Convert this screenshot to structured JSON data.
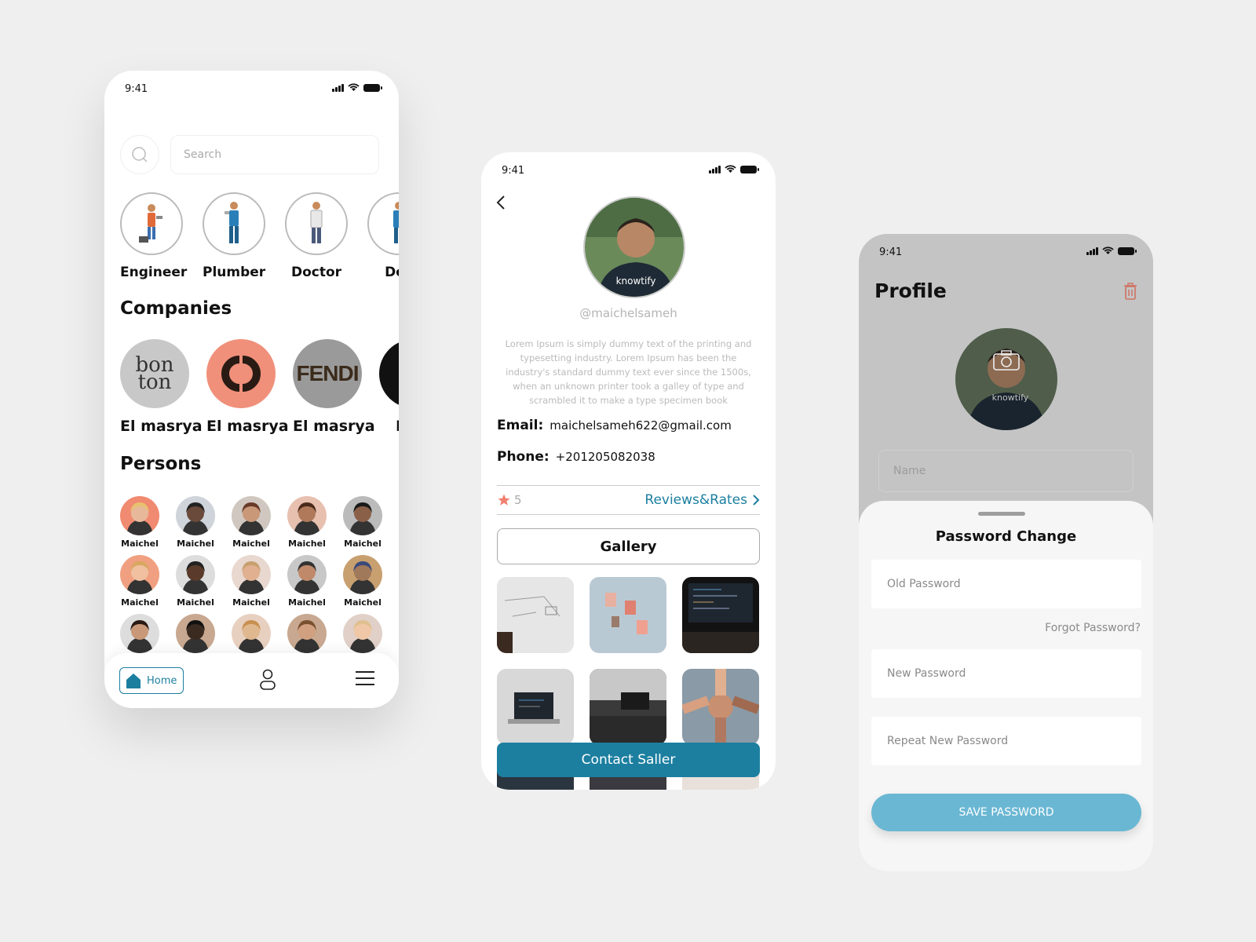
{
  "status": {
    "time": "9:41"
  },
  "home": {
    "search": {
      "placeholder": "Search"
    },
    "categories": [
      "Engineer",
      "Plumber",
      "Doctor",
      "Doc"
    ],
    "companies_title": "Companies",
    "companies": [
      {
        "name": "El masrya",
        "logo_text": "bon\nton",
        "color": "#c8c8c8"
      },
      {
        "name": "El masrya",
        "logo_text": "",
        "color": "#f0907a"
      },
      {
        "name": "El masrya",
        "logo_text": "FENDI",
        "color": "#9a9a9a"
      },
      {
        "name": "El m",
        "logo_text": "",
        "color": "#111111"
      }
    ],
    "persons_title": "Persons",
    "person_name": "Maichel",
    "nav": {
      "home_label": "Home"
    }
  },
  "profile": {
    "handle": "@maichelsameh",
    "bio": "Lorem Ipsum is simply dummy text of the printing and typesetting industry. Lorem Ipsum has been the industry's standard dummy text ever since the 1500s, when an unknown printer took a galley of type and scrambled it to make a type specimen book",
    "email_label": "Email:",
    "email": "maichelsameh622@gmail.com",
    "phone_label": "Phone:",
    "phone": "+201205082038",
    "rating": "5",
    "reviews_label": "Reviews&Rates",
    "gallery_label": "Gallery",
    "contact_label": "Contact Saller",
    "avatar_shirt_text": "knowtify"
  },
  "settings": {
    "title": "Profile",
    "name_placeholder": "Name",
    "sheet_title": "Password Change",
    "old_password_placeholder": "Old Password",
    "forgot_label": "Forgot Password?",
    "new_password_placeholder": "New Password",
    "repeat_password_placeholder": "Repeat New Password",
    "save_label": "SAVE PASSWORD"
  },
  "colors": {
    "accent": "#1c7fa0",
    "save": "#6ab7d3",
    "star": "#f08070"
  }
}
